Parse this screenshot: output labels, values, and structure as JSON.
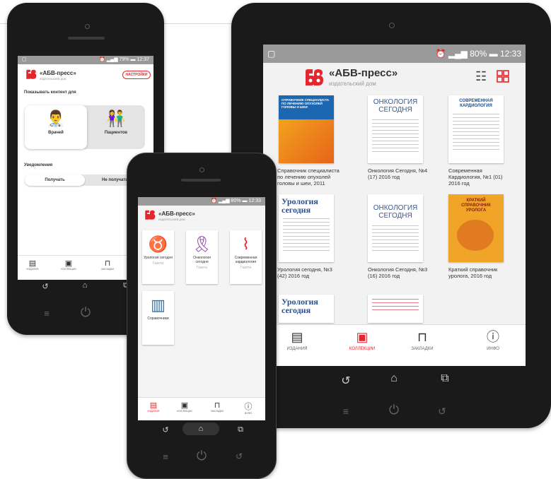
{
  "colors": {
    "accent": "#e2282e",
    "brand_gray": "#333333",
    "status_gray": "#9a9a9a"
  },
  "brand": {
    "name": "«АБВ-пресс»",
    "subtitle": "издательский дом"
  },
  "tablet": {
    "status": {
      "time": "12:33",
      "battery": "80%"
    },
    "header_icons": [
      "list-view-icon",
      "grid-view-icon"
    ],
    "covers": [
      {
        "title_art": "СПРАВОЧНИК СПЕЦИАЛИСТА ПО ЛЕЧЕНИЮ ОПУХОЛЕЙ ГОЛОВЫ И ШЕИ",
        "caption": "Справочник специалиста по лечению опухолей головы и шеи, 2011"
      },
      {
        "title_art": "ОНКОЛОГИЯ СЕГОДНЯ",
        "caption": "Онкология Сегодня, №4 (17) 2016 год"
      },
      {
        "title_art": "СОВРЕМЕННАЯ КАРДИОЛОГИЯ",
        "caption": "Современная Кардиология, №1 (01) 2016 год"
      },
      {
        "title_art": "Урология сегодня",
        "caption": "Урология сегодня, №3 (42) 2016 год"
      },
      {
        "title_art": "ОНКОЛОГИЯ СЕГОДНЯ",
        "caption": "Онкология Сегодня, №3 (16) 2016 год"
      },
      {
        "title_art": "КРАТКИЙ СПРАВОЧНИК УРОЛОГА",
        "caption": "Краткий справочник уролога, 2016 год"
      },
      {
        "title_art": "Урология сегодня",
        "caption": ""
      },
      {
        "title_art": "",
        "caption": ""
      }
    ],
    "tabbar": [
      {
        "icon": "editions-icon",
        "label": "ИЗДАНИЯ",
        "active": false
      },
      {
        "icon": "collections-icon",
        "label": "КОЛЛЕКЦИИ",
        "active": true
      },
      {
        "icon": "bookmark-icon",
        "label": "ЗАКЛАДКИ",
        "active": false
      },
      {
        "icon": "info-icon",
        "label": "ИНФО",
        "active": false
      }
    ]
  },
  "phone1": {
    "status": {
      "time": "12:37",
      "battery": "79%"
    },
    "settings_button": "НАСТРОЙКИ",
    "show_content_label": "Показывать контент для",
    "audience": [
      {
        "label": "Врачей",
        "selected": true
      },
      {
        "label": "Пациентов",
        "selected": false
      }
    ],
    "notifications_label": "Уведомления",
    "notify_options": [
      {
        "label": "Получать",
        "selected": true
      },
      {
        "label": "Не получать",
        "selected": false
      }
    ],
    "tabbar": [
      {
        "label": "ИЗДАНИЯ"
      },
      {
        "label": "КОЛЛЕКЦИИ"
      },
      {
        "label": "ЗАКЛАДКИ"
      }
    ]
  },
  "phone2": {
    "status": {
      "time": "12:33",
      "battery": "80%"
    },
    "tiles": [
      {
        "icon": "kidney-icon",
        "label": "Урология сегодня",
        "sub": "Газета"
      },
      {
        "icon": "ribbon-icon",
        "label": "Онкология сегодня",
        "sub": "Газета"
      },
      {
        "icon": "heartbeat-icon",
        "label": "Современная кардиология",
        "sub": "Газета"
      },
      {
        "icon": "books-icon",
        "label": "Справочники",
        "sub": ""
      }
    ],
    "tabbar": [
      {
        "label": "ИЗДАНИЯ",
        "active": true
      },
      {
        "label": "КОЛЛЕКЦИИ",
        "active": false
      },
      {
        "label": "ЗАКЛАДКИ",
        "active": false
      },
      {
        "label": "ИНФО",
        "active": false
      }
    ]
  }
}
